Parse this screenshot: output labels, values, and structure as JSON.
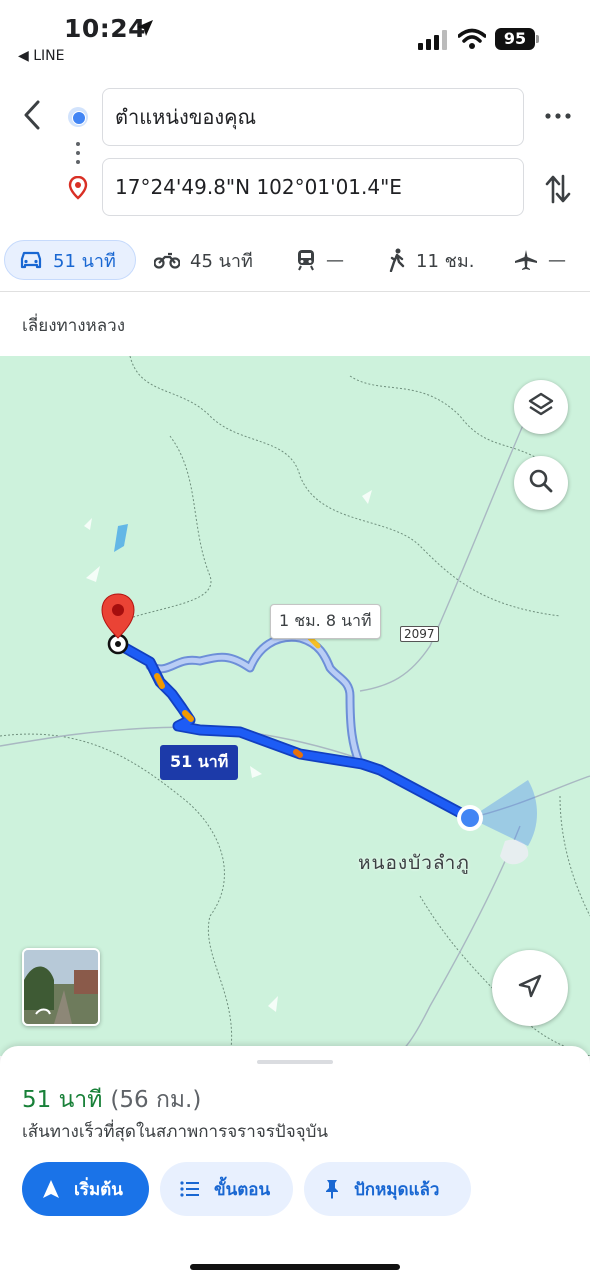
{
  "status_bar": {
    "time": "10:24",
    "back_app": "◀ LINE",
    "battery": "95"
  },
  "directions": {
    "origin": "ตำแหน่งของคุณ",
    "destination": "17°24'49.8\"N 102°01'01.4\"E"
  },
  "modes": [
    {
      "icon": "car-icon",
      "label": "51 นาที",
      "active": true
    },
    {
      "icon": "motorcycle-icon",
      "label": "45 นาที"
    },
    {
      "icon": "transit-icon",
      "label": "—"
    },
    {
      "icon": "walk-icon",
      "label": "11 ชม."
    },
    {
      "icon": "flight-icon",
      "label": "—"
    }
  ],
  "route_option": "เลี่ยงทางหลวง",
  "map": {
    "alt_route_label": "1 ชม. 8 นาที",
    "main_route_label": "51 นาที",
    "road_number": "2097",
    "town": "หนองบัวลำภู",
    "colors": {
      "land": "#cdf2dc",
      "route": "#1a5cf0",
      "alt_route": "#a8c4f8",
      "destination_pin": "#ea4335"
    }
  },
  "sheet": {
    "duration": "51 นาที",
    "distance": "(56 กม.)",
    "description": "เส้นทางเร็วที่สุดในสภาพการจราจรปัจจุบัน",
    "start_label": "เริ่มต้น",
    "steps_label": "ขั้นตอน",
    "pinned_label": "ปักหมุดแล้ว"
  }
}
